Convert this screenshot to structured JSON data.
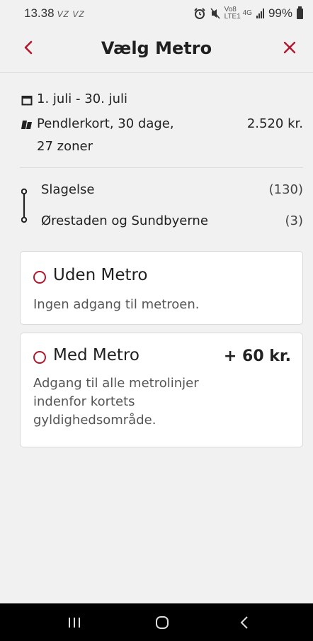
{
  "status": {
    "time": "13.38",
    "carrier": "VZ VZ",
    "lte": "Vo8 LTE1",
    "net": "4G",
    "battery": "99%"
  },
  "header": {
    "title": "Vælg Metro",
    "back_icon": "chevron-left-icon",
    "close_icon": "close-icon",
    "accent": "#b0172f"
  },
  "summary": {
    "period": "1. juli - 30. juli",
    "ticket_line1": "Pendlerkort, 30 dage,",
    "ticket_line2": "27 zoner",
    "price": "2.520 kr."
  },
  "route": {
    "from": "Slagelse",
    "from_zone": "(130)",
    "to": "Ørestaden og Sundbyerne",
    "to_zone": "(3)"
  },
  "options": [
    {
      "title": "Uden Metro",
      "desc_lines": [
        "Ingen adgang til metroen."
      ],
      "price": "",
      "selected": false
    },
    {
      "title": "Med Metro",
      "desc_lines": [
        "Adgang til alle metrolinjer",
        "indenfor kortets",
        "gyldighedsområde."
      ],
      "price": "+ 60 kr.",
      "selected": false
    }
  ]
}
